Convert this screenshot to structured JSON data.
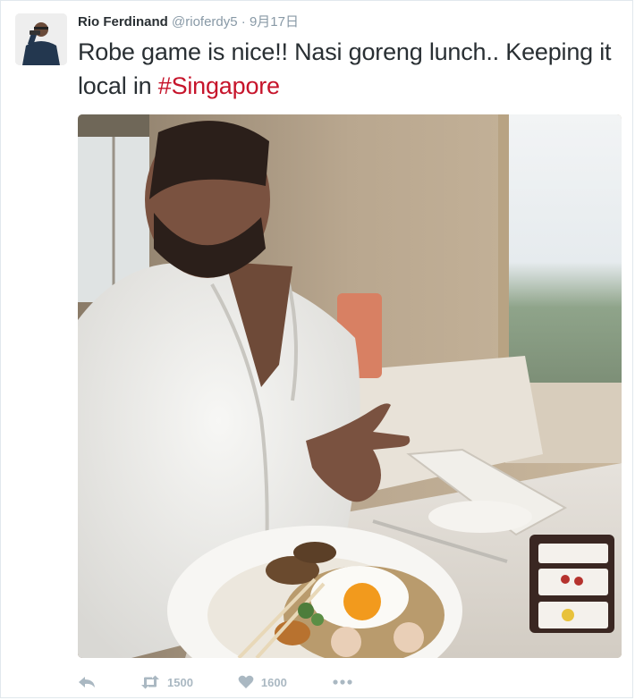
{
  "tweet": {
    "author_name": "Rio Ferdinand",
    "handle": "@rioferdy5",
    "separator": "·",
    "date": "9月17日",
    "text_main": "Robe game is nice!! Nasi goreng lunch.. Keeping it local in ",
    "hashtag": "#Singapore"
  },
  "actions": {
    "reply_icon": "reply-icon",
    "retweet_icon": "retweet-icon",
    "retweet_count": "1500",
    "like_icon": "heart-icon",
    "like_count": "1600",
    "more_icon": "more-icon"
  },
  "colors": {
    "hashtag": "#c6142b",
    "action_gray": "#aab8c2",
    "name": "#292f33",
    "meta": "#8899a6"
  }
}
